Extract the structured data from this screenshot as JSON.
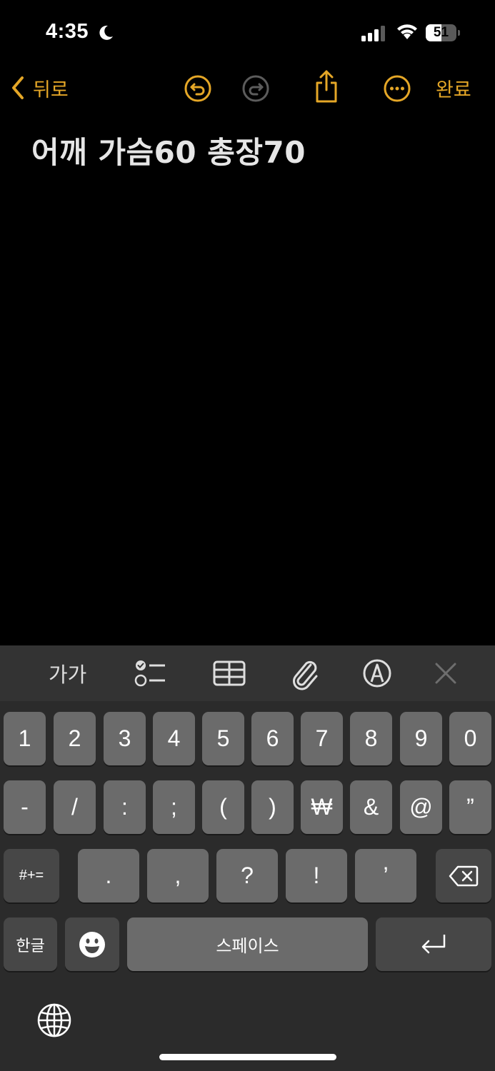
{
  "status_bar": {
    "time": "4:35",
    "battery_percent": "51",
    "battery_level": 0.51
  },
  "nav": {
    "back_label": "뒤로",
    "done_label": "완료",
    "accent_color": "#e5a727"
  },
  "note": {
    "title": "어깨 가슴60 총장70"
  },
  "toolbar": {
    "format_label": "가가"
  },
  "keyboard": {
    "row1": [
      "1",
      "2",
      "3",
      "4",
      "5",
      "6",
      "7",
      "8",
      "9",
      "0"
    ],
    "row2": [
      "-",
      "/",
      ":",
      ";",
      "(",
      ")",
      "₩",
      "&",
      "@",
      "”"
    ],
    "row3": [
      ".",
      ",",
      "?",
      "!",
      "’"
    ],
    "symbols_label": "#+=",
    "hangul_label": "한글",
    "space_label": "스페이스"
  }
}
